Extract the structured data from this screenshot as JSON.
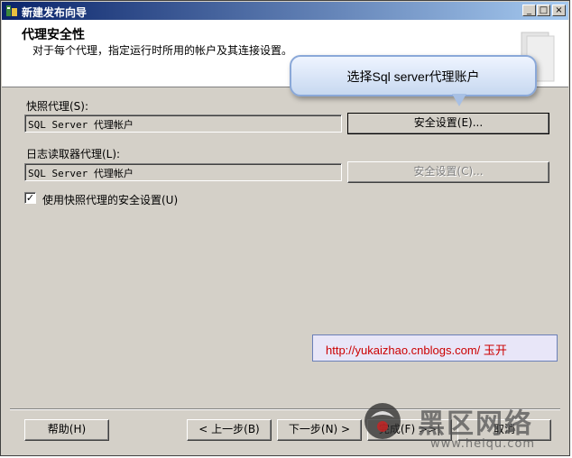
{
  "window": {
    "title": "新建发布向导",
    "controls": [
      "_",
      "□",
      "×"
    ]
  },
  "header": {
    "title": "代理安全性",
    "subtitle": "对于每个代理，指定运行时所用的帐户及其连接设置。"
  },
  "callout": {
    "text": "选择Sql server代理账户"
  },
  "snapshot": {
    "label": "快照代理(S):",
    "value": "SQL Server 代理帐户",
    "button": "安全设置(E)..."
  },
  "logreader": {
    "label": "日志读取器代理(L):",
    "value": "SQL Server 代理帐户",
    "button": "安全设置(C)..."
  },
  "use_snapshot_security": {
    "checked": true,
    "check_mark": "✓",
    "label": "使用快照代理的安全设置(U)"
  },
  "annotation": {
    "url": "http://yukaizhao.cnblogs.com/ 玉开"
  },
  "footer": {
    "help": "帮助(H)",
    "back": "< 上一步(B)",
    "next": "下一步(N) >",
    "finish": "完成(F) >>|",
    "cancel": "取消"
  },
  "watermark": {
    "brand": "黑区网络",
    "url": "www.heiqu.com"
  }
}
